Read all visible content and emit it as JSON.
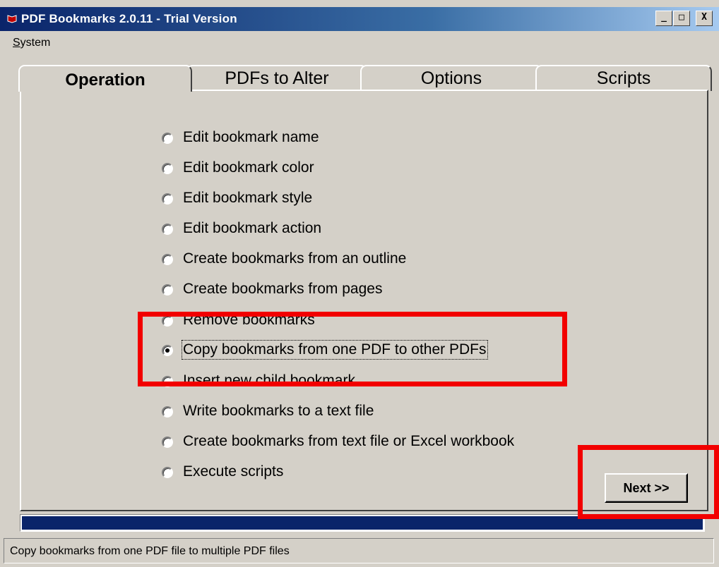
{
  "window": {
    "title": "PDF Bookmarks 2.0.11 - Trial Version",
    "minimize_glyph": "_",
    "maximize_glyph": "□",
    "close_glyph": "X"
  },
  "menu": {
    "system_accel": "S",
    "system_rest": "ystem"
  },
  "tabs": [
    {
      "label": "Operation",
      "active": true
    },
    {
      "label": "PDFs to Alter",
      "active": false
    },
    {
      "label": "Options",
      "active": false
    },
    {
      "label": "Scripts",
      "active": false
    }
  ],
  "operations": [
    {
      "label": "Edit bookmark name",
      "selected": false
    },
    {
      "label": "Edit bookmark color",
      "selected": false
    },
    {
      "label": "Edit bookmark style",
      "selected": false
    },
    {
      "label": "Edit bookmark action",
      "selected": false
    },
    {
      "label": "Create bookmarks from an outline",
      "selected": false
    },
    {
      "label": "Create bookmarks from pages",
      "selected": false
    },
    {
      "label": "Remove bookmarks",
      "selected": false
    },
    {
      "label": "Copy bookmarks from one PDF to other PDFs",
      "selected": true
    },
    {
      "label": "Insert new child bookmark",
      "selected": false
    },
    {
      "label": "Write bookmarks to a text file",
      "selected": false
    },
    {
      "label": "Create bookmarks from text file or Excel workbook",
      "selected": false
    },
    {
      "label": "Execute scripts",
      "selected": false
    }
  ],
  "next_button": {
    "label": "Next >>"
  },
  "progress": {
    "fraction": 1.0
  },
  "status": {
    "text": "Copy bookmarks from one PDF file to multiple PDF files"
  },
  "colors": {
    "title_start": "#0a246a",
    "title_end": "#a6caf0",
    "face": "#d4d0c8",
    "progress": "#0a246a",
    "highlight": "#f20000"
  }
}
